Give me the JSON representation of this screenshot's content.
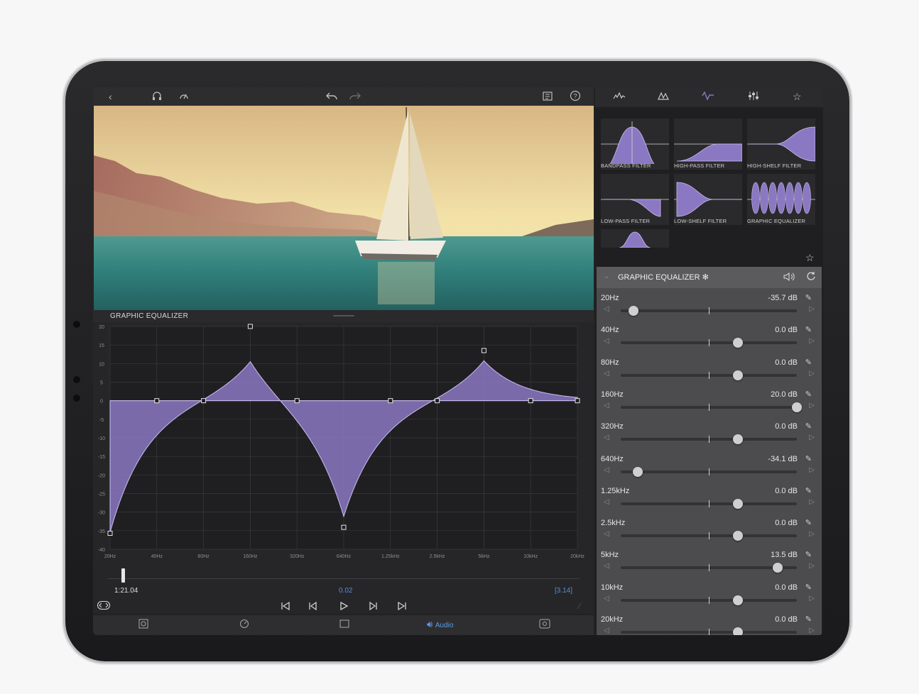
{
  "toolbar": {
    "icons": [
      "back-icon",
      "headphones-icon",
      "speed-icon",
      "undo-icon",
      "redo-icon",
      "clipboard-icon",
      "help-icon"
    ]
  },
  "video": {
    "description_colors": {
      "sky": "#f0dca0",
      "sea": "#3a8a84"
    }
  },
  "eq_panel_title": "GRAPHIC EQUALIZER",
  "timeline": {
    "current_time": "1:21.04",
    "playhead_value": "0.02",
    "duration": "[3.14]",
    "accent": "#4f8fd8"
  },
  "bottombar": {
    "audio_label": "Audio",
    "accent": "#5b9ee8"
  },
  "right_tabs": [
    "waveform-icon",
    "peaks-icon",
    "eq-curve-icon",
    "mixer-icon",
    "star-icon"
  ],
  "presets": [
    {
      "label": "BANDPASS FILTER",
      "shape": "bandpass"
    },
    {
      "label": "HIGH-PASS FILTER",
      "shape": "highpass"
    },
    {
      "label": "HIGH-SHELF FILTER",
      "shape": "highshelf"
    },
    {
      "label": "LOW-PASS FILTER",
      "shape": "lowpass"
    },
    {
      "label": "LOW-SHELF FILTER",
      "shape": "lowshelf"
    },
    {
      "label": "GRAPHIC EQUALIZER",
      "shape": "graphic"
    }
  ],
  "effect": {
    "title": "GRAPHIC EQUALIZER ✻",
    "range_db": [
      -40,
      20
    ]
  },
  "bands": [
    {
      "freq": "20Hz",
      "value_label": "-35.7 dB",
      "db": -35.7
    },
    {
      "freq": "40Hz",
      "value_label": "0.0 dB",
      "db": 0.0
    },
    {
      "freq": "80Hz",
      "value_label": "0.0 dB",
      "db": 0.0
    },
    {
      "freq": "160Hz",
      "value_label": "20.0 dB",
      "db": 20.0
    },
    {
      "freq": "320Hz",
      "value_label": "0.0 dB",
      "db": 0.0
    },
    {
      "freq": "640Hz",
      "value_label": "-34.1 dB",
      "db": -34.1
    },
    {
      "freq": "1.25kHz",
      "value_label": "0.0 dB",
      "db": 0.0
    },
    {
      "freq": "2.5kHz",
      "value_label": "0.0 dB",
      "db": 0.0
    },
    {
      "freq": "5kHz",
      "value_label": "13.5 dB",
      "db": 13.5
    },
    {
      "freq": "10kHz",
      "value_label": "0.0 dB",
      "db": 0.0
    },
    {
      "freq": "20kHz",
      "value_label": "0.0 dB",
      "db": 0.0
    }
  ],
  "chart_data": {
    "type": "area",
    "title": "GRAPHIC EQUALIZER",
    "categories": [
      "20Hz",
      "40Hz",
      "80Hz",
      "160Hz",
      "320Hz",
      "640Hz",
      "1.25kHz",
      "2.5kHz",
      "5kHz",
      "10kHz",
      "20kHz"
    ],
    "y_ticks": [
      "20",
      "15",
      "10",
      "5",
      "0",
      "-5",
      "-10",
      "-15",
      "-20",
      "-25",
      "-30",
      "-35",
      "-40"
    ],
    "nodes_db": [
      -35.7,
      0,
      0,
      20,
      0,
      -34.1,
      0,
      0,
      13.5,
      0,
      0
    ],
    "curve_peaks_db": [
      -35.7,
      0,
      0,
      14,
      0,
      -32.5,
      0,
      0,
      11.5,
      0,
      0
    ],
    "ylim": [
      -40,
      20
    ],
    "grid": true,
    "fill_color": "#8b78c2",
    "line_color": "#cbbdf0"
  }
}
